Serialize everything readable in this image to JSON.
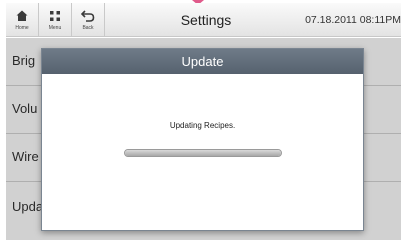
{
  "header": {
    "nav": [
      {
        "label": "Home",
        "icon": "home-icon"
      },
      {
        "label": "Menu",
        "icon": "menu-grid-icon"
      },
      {
        "label": "Back",
        "icon": "back-arrow-icon"
      }
    ],
    "title": "Settings",
    "datetime": "07.18.2011 08:11PM"
  },
  "settings_list": [
    {
      "label": "Brig"
    },
    {
      "label": "Volu"
    },
    {
      "label": "Wire"
    },
    {
      "label": "Upda"
    }
  ],
  "dialog": {
    "title": "Update",
    "message": "Updating Recipes.",
    "progress_fraction": 1.0
  },
  "colors": {
    "dialog_header": "#626d7a",
    "progress_track": "#cfcfcf",
    "top_indicator": "#e05a8a"
  }
}
